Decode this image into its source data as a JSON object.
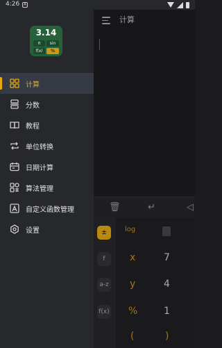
{
  "status_bar": {
    "time": "4:26",
    "notification_glyph": "A"
  },
  "app": {
    "title": "计算",
    "keypad": {
      "fn_keys": [
        "f",
        "a-z",
        "f(x)"
      ],
      "row1": [
        "log",
        ""
      ],
      "row2": [
        "x",
        "7"
      ],
      "row3": [
        "y",
        "4"
      ],
      "row4": [
        "%",
        "1"
      ],
      "row5": [
        "(",
        ")"
      ]
    }
  },
  "drawer": {
    "logo": {
      "value": "3.14",
      "chip_pi": "π",
      "chip_sin": "sin",
      "chip_fx": "f(x)",
      "chip_pct": "%"
    },
    "items": [
      {
        "label": "计算",
        "icon": "grid-icon",
        "active": true
      },
      {
        "label": "分数",
        "icon": "fraction-icon",
        "active": false
      },
      {
        "label": "教程",
        "icon": "book-icon",
        "active": false
      },
      {
        "label": "单位转换",
        "icon": "convert-icon",
        "active": false
      },
      {
        "label": "日期计算",
        "icon": "calendar-icon",
        "active": false
      },
      {
        "label": "算法管理",
        "icon": "algorithm-icon",
        "active": false
      },
      {
        "label": "自定义函数管理",
        "icon": "custom-function-icon",
        "active": false
      },
      {
        "label": "设置",
        "icon": "settings-icon",
        "active": false
      }
    ]
  },
  "colors": {
    "accent": "#e7a90f",
    "drawer_bg": "#26282c",
    "active_item_bg": "#353a45",
    "logo_bg": "#27613a"
  }
}
